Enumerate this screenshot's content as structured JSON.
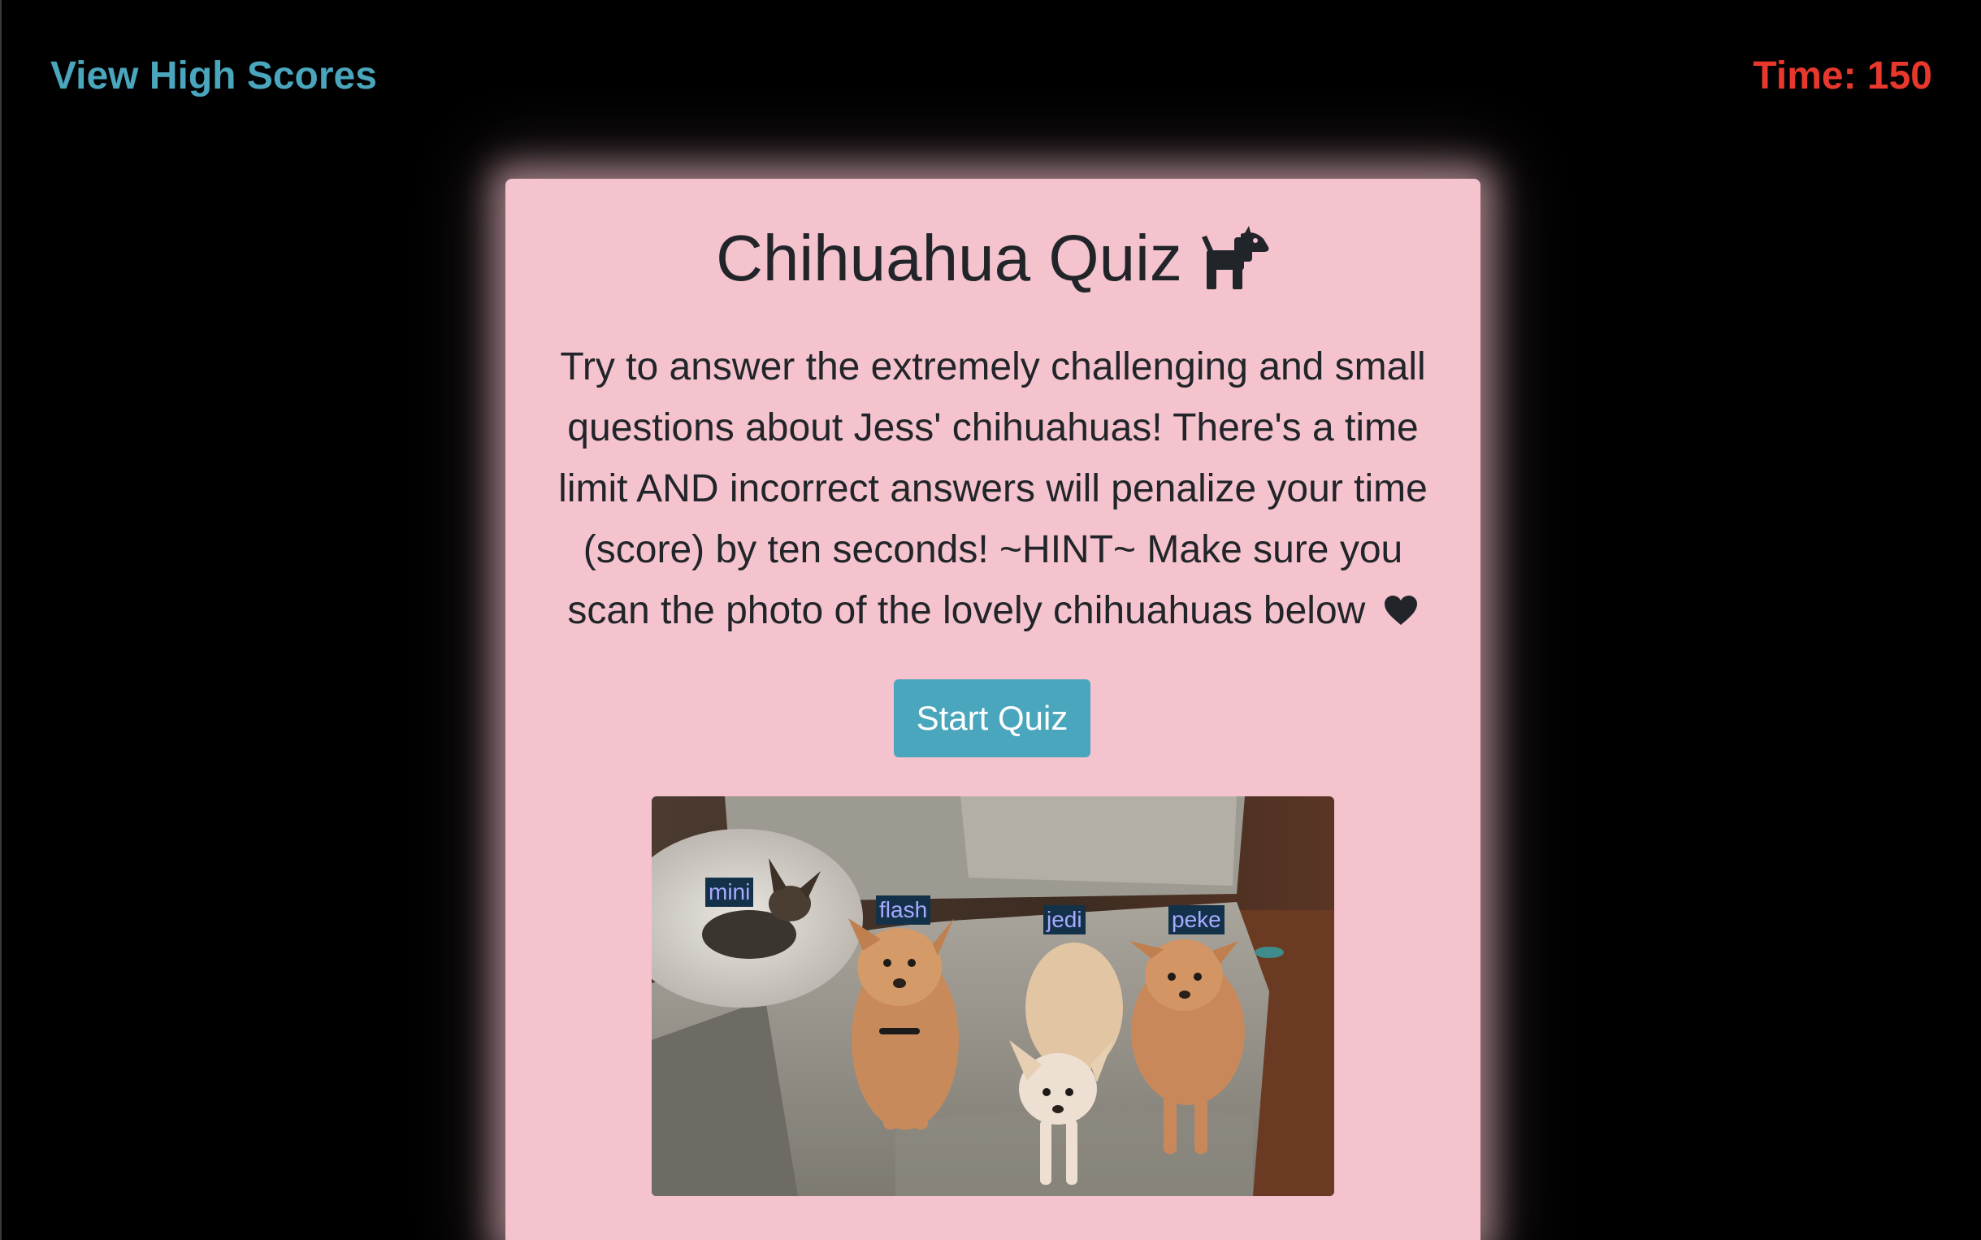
{
  "header": {
    "high_scores_label": "View High Scores",
    "timer_label": "Time: 150"
  },
  "card": {
    "title": "Chihuahua Quiz",
    "title_icon": "dog-icon",
    "description": "Try to answer the extremely challenging and small questions about Jess' chihuahuas! There's a time limit AND incorrect answers will penalize your time (score) by ten seconds! ~HINT~ Make sure you scan the photo of the lovely chihuahuas below",
    "description_icon": "heart-icon",
    "start_button_label": "Start Quiz"
  },
  "photo": {
    "labels": [
      "mini",
      "flash",
      "jedi",
      "peke"
    ]
  },
  "colors": {
    "background": "#000000",
    "card": "#f5c3cd",
    "accent": "#4aa6bd",
    "timer": "#e8382d",
    "text": "#212529"
  }
}
